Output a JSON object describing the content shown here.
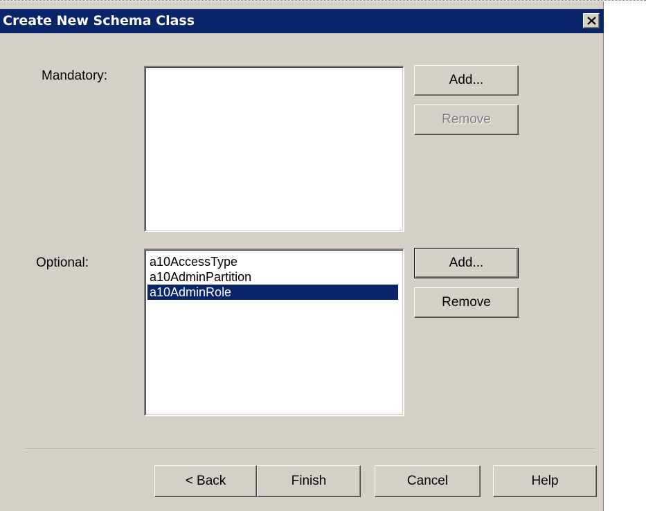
{
  "dialog": {
    "title": "Create New Schema Class",
    "close_symbol": "close-icon"
  },
  "mandatory": {
    "label": "Mandatory:",
    "items": [],
    "add_label": "Add...",
    "remove_label": "Remove"
  },
  "optional": {
    "label": "Optional:",
    "items": [
      "a10AccessType",
      "a10AdminPartition",
      "a10AdminRole"
    ],
    "selected": "a10AdminRole",
    "add_label": "Add...",
    "remove_label": "Remove"
  },
  "footer": {
    "back_label": "< Back",
    "finish_label": "Finish",
    "cancel_label": "Cancel",
    "help_label": "Help"
  },
  "colors": {
    "titlebar": "#0a246a",
    "dialog_bg": "#d4d0c8",
    "selection": "#0a246a"
  }
}
